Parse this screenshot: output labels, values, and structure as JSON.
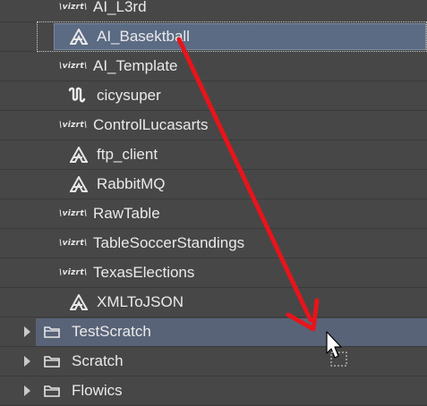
{
  "tree": {
    "items": [
      {
        "label": "AI_L3rd",
        "icon": "vizrt-icon"
      },
      {
        "label": "AI_Basektball",
        "icon": "artist-a-icon"
      },
      {
        "label": "AI_Template",
        "icon": "vizrt-icon"
      },
      {
        "label": "cicysuper",
        "icon": "unreal-icon"
      },
      {
        "label": "ControlLucasarts",
        "icon": "vizrt-icon"
      },
      {
        "label": "ftp_client",
        "icon": "artist-a-icon"
      },
      {
        "label": "RabbitMQ",
        "icon": "artist-a-icon"
      },
      {
        "label": "RawTable",
        "icon": "vizrt-icon"
      },
      {
        "label": "TableSoccerStandings",
        "icon": "vizrt-icon"
      },
      {
        "label": "TexasElections",
        "icon": "vizrt-icon"
      },
      {
        "label": "XMLToJSON",
        "icon": "artist-a-icon"
      }
    ],
    "folders": [
      {
        "label": "TestScratch",
        "icon": "folder-icon"
      },
      {
        "label": "Scratch",
        "icon": "folder-icon"
      },
      {
        "label": "Flowics",
        "icon": "folder-icon"
      }
    ],
    "vizrt_logo_text": "\\vizrt\\"
  },
  "colors": {
    "background": "#474747",
    "selection": "#5b6b84",
    "drop_target": "#586377",
    "annotation_arrow": "#e8141b"
  }
}
